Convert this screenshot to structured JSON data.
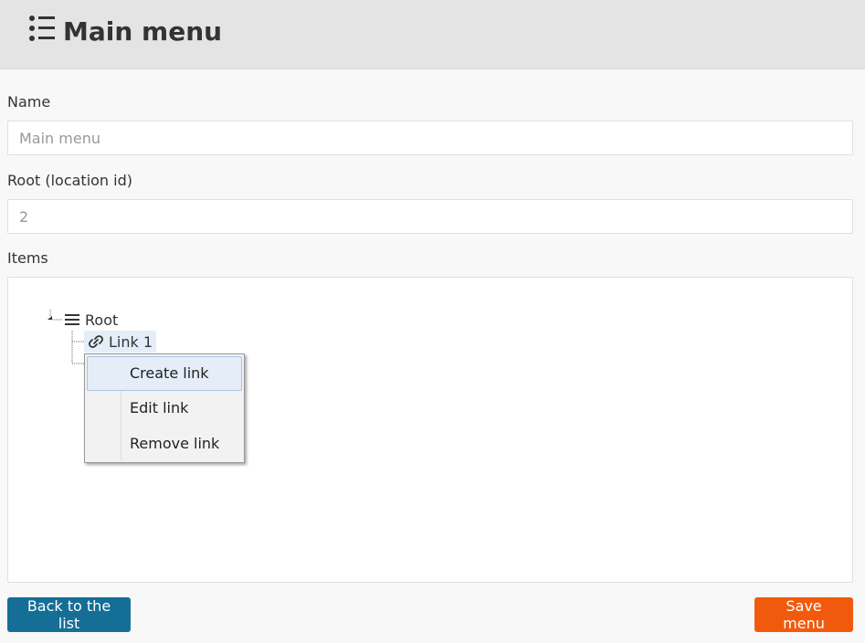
{
  "header": {
    "title": "Main menu",
    "icon": "list-icon"
  },
  "form": {
    "name_label": "Name",
    "name_placeholder": "Main menu",
    "root_label": "Root (location id)",
    "root_placeholder": "2",
    "items_label": "Items"
  },
  "tree": {
    "root": {
      "label": "Root",
      "icon": "hamburger-icon"
    },
    "children": [
      {
        "label": "Link 1",
        "icon": "link-icon"
      }
    ]
  },
  "context_menu": {
    "items": [
      {
        "label": "Create link",
        "highlighted": true
      },
      {
        "label": "Edit link"
      },
      {
        "label": "Remove link"
      }
    ]
  },
  "buttons": {
    "back_label": "Back to the list",
    "save_label": "Save menu"
  },
  "colors": {
    "primary": "#146e96",
    "accent": "#f15a0c",
    "header_bg": "#e5e4e4"
  }
}
